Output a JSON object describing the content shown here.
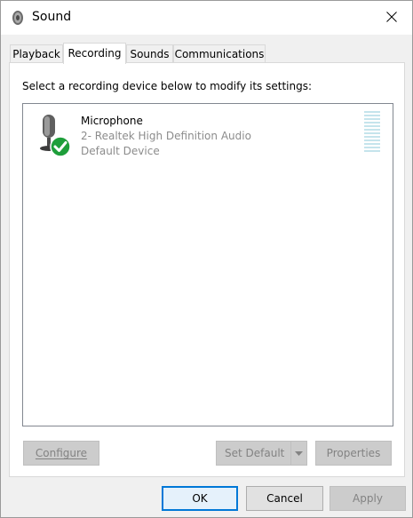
{
  "window": {
    "title": "Sound"
  },
  "tabs": [
    {
      "label": "Playback"
    },
    {
      "label": "Recording"
    },
    {
      "label": "Sounds"
    },
    {
      "label": "Communications"
    }
  ],
  "panel": {
    "instruction": "Select a recording device below to modify its settings:",
    "device": {
      "name": "Microphone",
      "description": "2- Realtek High Definition Audio",
      "status": "Default Device",
      "icon": "microphone-icon",
      "status_icon": "green-check-icon",
      "level_fraction": 0.0
    },
    "buttons": {
      "configure": "Configure",
      "set_default": "Set Default",
      "properties": "Properties"
    }
  },
  "dialog_buttons": {
    "ok": "OK",
    "cancel": "Cancel",
    "apply": "Apply"
  },
  "colors": {
    "accent": "#0078d7",
    "check_green": "#1e9e3a",
    "meter_empty": "#c5e4ec"
  }
}
